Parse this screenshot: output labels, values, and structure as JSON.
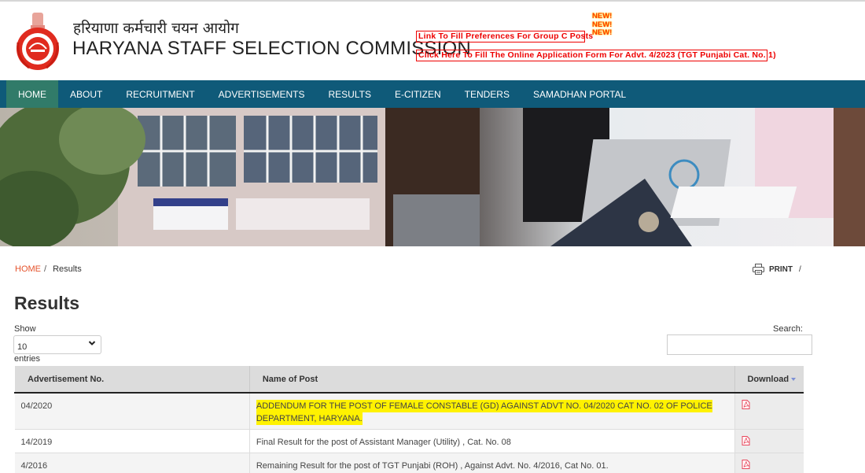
{
  "header": {
    "title_hindi": "हरियाणा कर्मचारी चयन आयोग",
    "title_english": "HARYANA STAFF SELECTION COMMISSION",
    "logo_icon": "haryana-emblem",
    "notices": [
      {
        "label": "Link To Fill Preferences For Group C Posts"
      },
      {
        "label": "Click Here To Fill The Online Application Form For Advt. 4/2023 (TGT Punjabi Cat. No. 1)"
      }
    ],
    "new_badge": [
      "NEW!",
      "NEW!",
      "NEW!"
    ]
  },
  "colors": {
    "nav_bg": "#0f5a79",
    "nav_active": "#317b69",
    "notice_red": "#e00000",
    "breadcrumb_home": "#e5532c",
    "highlight": "#fff200",
    "pdf_icon": "#e8455a"
  },
  "nav": {
    "items": [
      {
        "label": "HOME",
        "active": true
      },
      {
        "label": "ABOUT"
      },
      {
        "label": "RECRUITMENT"
      },
      {
        "label": "ADVERTISEMENTS"
      },
      {
        "label": "RESULTS"
      },
      {
        "label": "E-CITIZEN"
      },
      {
        "label": "TENDERS"
      },
      {
        "label": "SAMADHAN PORTAL"
      }
    ]
  },
  "breadcrumb": {
    "home": "HOME",
    "separator": "/",
    "current": "Results"
  },
  "print": {
    "label": "PRINT",
    "separator": "/",
    "icon": "printer-icon"
  },
  "page": {
    "title": "Results"
  },
  "table_controls": {
    "show_label": "Show",
    "entries_value": "10",
    "entries_label": "entries",
    "search_label": "Search:",
    "search_value": ""
  },
  "table": {
    "columns": [
      "Advertisement No.",
      "Name of Post",
      "Download"
    ],
    "rows": [
      {
        "adv_no": "04/2020",
        "post": "ADDENDUM FOR THE POST OF FEMALE CONSTABLE (GD) AGAINST ADVT NO. 04/2020 CAT NO. 02 OF POLICE DEPARTMENT, HARYANA.",
        "highlighted": true,
        "download_icon": "pdf-icon"
      },
      {
        "adv_no": "14/2019",
        "post": "Final Result for the post of Assistant Manager (Utility) , Cat. No. 08",
        "download_icon": "pdf-icon"
      },
      {
        "adv_no": "4/2016",
        "post": "Remaining Result for the post of TGT Punjabi (ROH) , Against Advt. No. 4/2016, Cat No. 01.",
        "download_icon": "pdf-icon"
      }
    ]
  }
}
